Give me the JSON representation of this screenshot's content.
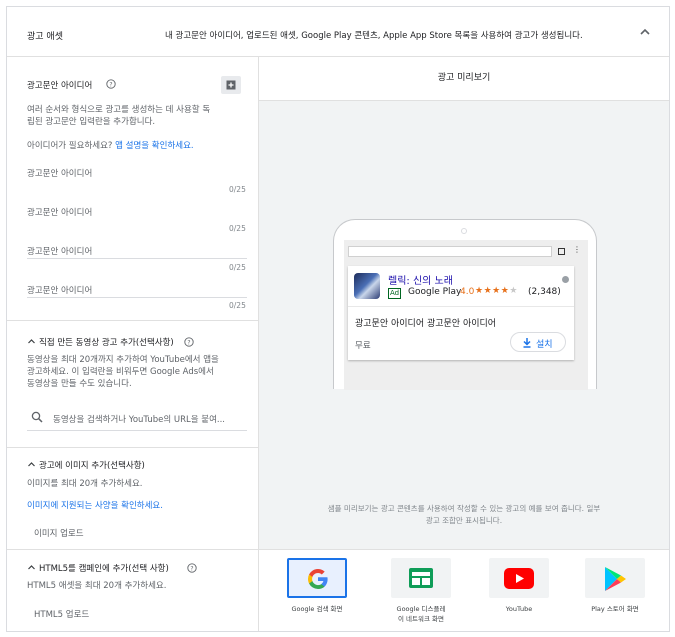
{
  "header": {
    "title": "광고 애셋",
    "description": "내 광고문안 아이디어, 업로드된 애셋, Google Play 콘텐츠, Apple App Store 목록을 사용하여 광고가 생성됩니다."
  },
  "ideas": {
    "title": "광고문안 아이디어",
    "desc_line1": "여러 순서와 형식으로 광고를 생성하는 데 사용할 독",
    "desc_line2": "립된 광고문안 입력란을 추가합니다.",
    "need_prefix": "아이디어가 필요하세요?",
    "need_link": "앱 설명을 확인하세요.",
    "fields": [
      {
        "placeholder": "광고문안 아이디어",
        "counter": "0/25"
      },
      {
        "placeholder": "광고문안 아이디어",
        "counter": "0/25"
      },
      {
        "placeholder": "광고문안 아이디어",
        "counter": "0/25"
      },
      {
        "placeholder": "광고문안 아이디어",
        "counter": "0/25"
      }
    ]
  },
  "video": {
    "title": "직접 만든 동영상 광고 추가(선택사항)",
    "desc_line1": "동영상을 최대 20개까지 추가하여 YouTube에서 앱을",
    "desc_line2": "광고하세요. 이 입력란을 비워두면 Google Ads에서",
    "desc_line3": "동영상을 만들 수도 있습니다.",
    "search_placeholder": "동영상을 검색하거나 YouTube의 URL을 붙여..."
  },
  "image": {
    "title": "광고에 이미지 추가(선택사항)",
    "desc": "이미지를 최대 20개 추가하세요.",
    "link": "이미지에 지원되는 사양을 확인하세요.",
    "upload": "이미지 업로드"
  },
  "html5": {
    "title": "HTML5를 캠페인에 추가(선택 사항)",
    "desc": "HTML5 애셋을 최대 20개 추가하세요.",
    "upload": "HTML5 업로드"
  },
  "preview": {
    "title": "광고 미리보기",
    "app_name": "렐릭: 신의 노래",
    "ad_badge": "Ad",
    "store": "Google Play",
    "rating": "4.0",
    "rating_stars": 4,
    "stars_text": "★★★★★",
    "reviews": "(2,348)",
    "headline": "광고문안 아이디어 광고문안 아이디어",
    "price": "무료",
    "install": "설치",
    "note_line1": "샘플 미리보기는 광고 콘텐츠를 사용하여 작성할 수 있는 광고의 예를 보여 줍니다. 일부",
    "note_line2": "광고 조합만 표시됩니다."
  },
  "formats": [
    {
      "label": "Google 검색 화면",
      "icon": "google-g-icon",
      "selected": true
    },
    {
      "label1": "Google 디스플레",
      "label2": "이 네트워크 화면",
      "icon": "display-network-icon",
      "selected": false
    },
    {
      "label": "YouTube",
      "icon": "youtube-icon",
      "selected": false
    },
    {
      "label": "Play 스토어 화면",
      "icon": "play-store-icon",
      "selected": false
    }
  ],
  "colors": {
    "link": "#1a73e8",
    "star": "#e7711b",
    "ad_green": "#006621",
    "selected_border": "#1a73e8"
  }
}
